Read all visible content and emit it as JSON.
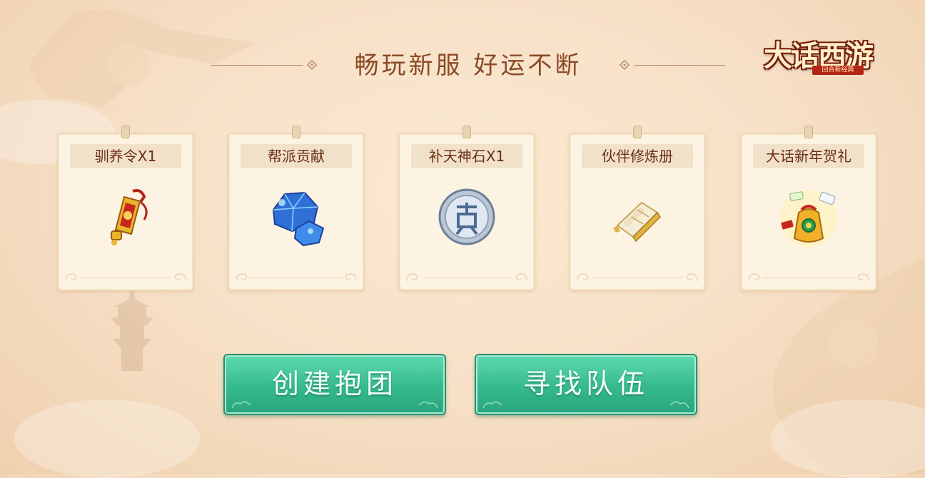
{
  "header": {
    "title": "畅玩新服 好运不断"
  },
  "logo": {
    "text": "大话西游",
    "sub": "回合新经典"
  },
  "rewards": [
    {
      "label": "驯养令X1",
      "icon": "tame-token-icon"
    },
    {
      "label": "帮派贡献",
      "icon": "blue-crystal-icon"
    },
    {
      "label": "补天神石X1",
      "icon": "silver-coin-icon"
    },
    {
      "label": "伙伴修炼册",
      "icon": "training-book-icon"
    },
    {
      "label": "大话新年贺礼",
      "icon": "new-year-gift-bag-icon"
    }
  ],
  "buttons": {
    "create_label": "创建抱团",
    "find_label": "寻找队伍"
  },
  "colors": {
    "title": "#8a4a26",
    "label": "#6b2d14",
    "button": "#35b98d",
    "card_bg": "#fdf3e2"
  }
}
